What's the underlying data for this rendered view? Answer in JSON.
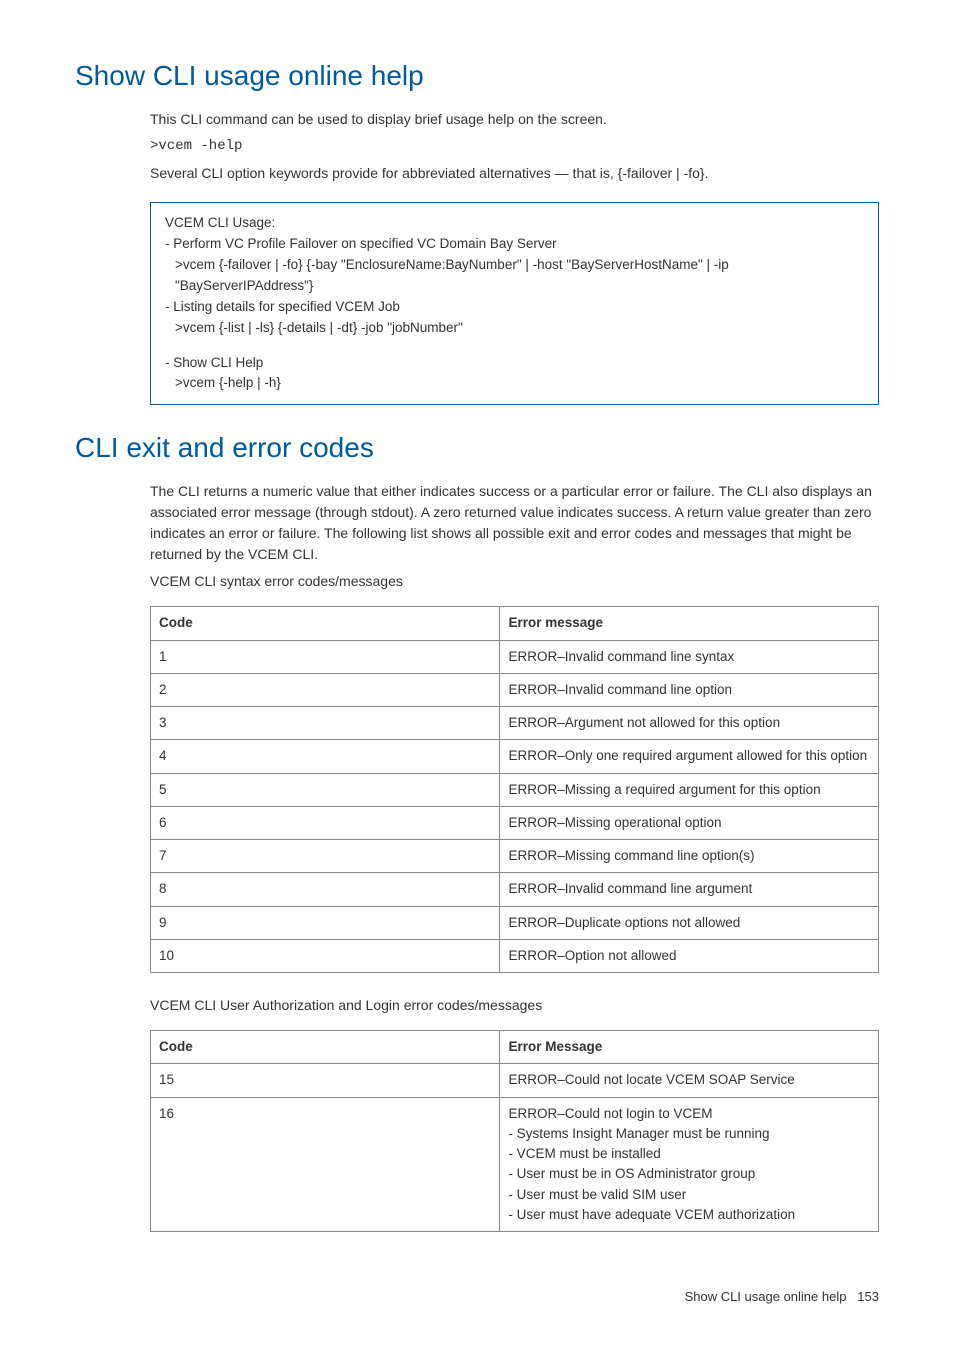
{
  "section1": {
    "heading": "Show CLI usage online help",
    "intro": "This CLI command can be used to display brief usage help on the screen.",
    "command": ">vcem -help",
    "desc": "Several CLI option keywords provide for abbreviated alternatives — that is, {-failover | -fo}.",
    "usage": {
      "title": "VCEM CLI Usage:",
      "item1_label": "- Perform VC Profile Failover on specified VC Domain Bay Server",
      "item1_cmd": ">vcem {-failover | -fo} {-bay \"EnclosureName:BayNumber\" | -host \"BayServerHostName\" | -ip \"BayServerIPAddress\"}",
      "item2_label": "- Listing details for specified VCEM Job",
      "item2_cmd": ">vcem {-list | -ls} {-details | -dt} -job \"jobNumber\"",
      "item3_label": "- Show CLI Help",
      "item3_cmd": ">vcem {-help | -h}"
    }
  },
  "section2": {
    "heading": "CLI exit and error codes",
    "intro": "The CLI returns a numeric value that either indicates success or a particular error or failure. The CLI also displays an associated error message (through stdout). A zero returned value indicates success. A return value greater than zero indicates an error or failure. The following list shows all possible exit and error codes and messages that might be returned by the VCEM CLI.",
    "table1_caption": "VCEM CLI syntax error codes/messages",
    "table1": {
      "header_code": "Code",
      "header_msg": "Error message",
      "rows": [
        {
          "code": "1",
          "msg": "ERROR–Invalid command line syntax"
        },
        {
          "code": "2",
          "msg": "ERROR–Invalid command line option"
        },
        {
          "code": "3",
          "msg": "ERROR–Argument not allowed for this option"
        },
        {
          "code": "4",
          "msg": "ERROR–Only one required argument allowed for this option"
        },
        {
          "code": "5",
          "msg": "ERROR–Missing a required argument for this option"
        },
        {
          "code": "6",
          "msg": "ERROR–Missing operational option"
        },
        {
          "code": "7",
          "msg": "ERROR–Missing command line option(s)"
        },
        {
          "code": "8",
          "msg": "ERROR–Invalid command line argument"
        },
        {
          "code": "9",
          "msg": "ERROR–Duplicate options not allowed"
        },
        {
          "code": "10",
          "msg": "ERROR–Option not allowed"
        }
      ]
    },
    "table2_caption": "VCEM CLI User Authorization and Login error codes/messages",
    "table2": {
      "header_code": "Code",
      "header_msg": "Error Message",
      "rows": [
        {
          "code": "15",
          "msg_lines": [
            "ERROR–Could not locate VCEM SOAP Service"
          ]
        },
        {
          "code": "16",
          "msg_lines": [
            "ERROR–Could not login to VCEM",
            "- Systems Insight Manager must be running",
            "- VCEM must be installed",
            "- User must be in OS Administrator group",
            "- User must be valid SIM user",
            "- User must have adequate VCEM authorization"
          ]
        }
      ]
    }
  },
  "footer": {
    "label": "Show CLI usage online help",
    "page": "153"
  }
}
